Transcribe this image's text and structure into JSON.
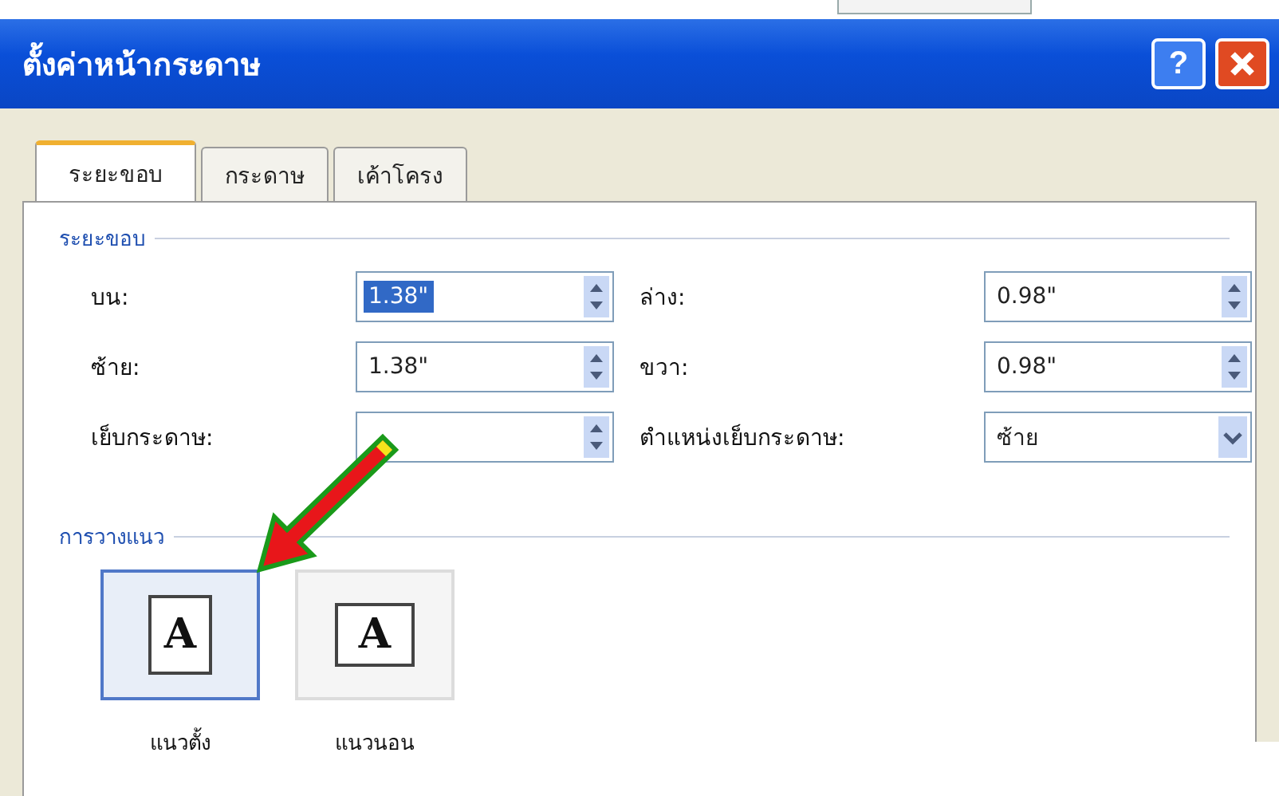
{
  "window": {
    "title": "ตั้งค่าหน้ากระดาษ",
    "help_label": "?"
  },
  "tabs": [
    {
      "label": "ระยะขอบ",
      "selected": true
    },
    {
      "label": "กระดาษ",
      "selected": false
    },
    {
      "label": "เค้าโครง",
      "selected": false
    }
  ],
  "margins": {
    "heading": "ระยะขอบ",
    "fields": [
      {
        "label": "บน:",
        "value": "1.38\"",
        "kind": "spin",
        "highlighted": true
      },
      {
        "label": "ล่าง:",
        "value": "0.98\"",
        "kind": "spin",
        "highlighted": false
      },
      {
        "label": "ซ้าย:",
        "value": "1.38\"",
        "kind": "spin",
        "highlighted": false
      },
      {
        "label": "ขวา:",
        "value": "0.98\"",
        "kind": "spin",
        "highlighted": false
      },
      {
        "label": "เย็บกระดาษ:",
        "kind": "spin",
        "highlighted": false
      },
      {
        "label": "ตำแหน่งเย็บกระดาษ:",
        "value": "ซ้าย",
        "kind": "dropdown",
        "highlighted": false
      }
    ]
  },
  "orientation": {
    "heading": "การวางแนว",
    "options": [
      {
        "label": "แนวตั้ง",
        "kind": "portrait",
        "letter": "A",
        "selected": true
      },
      {
        "label": "แนวนอน",
        "kind": "landscape",
        "letter": "A",
        "selected": false
      }
    ]
  },
  "annotation": {
    "kind": "arrow"
  }
}
